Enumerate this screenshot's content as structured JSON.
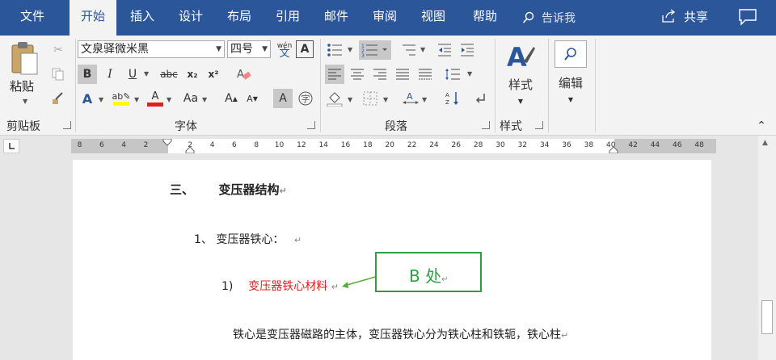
{
  "tabs": {
    "file": "文件",
    "home": "开始",
    "insert": "插入",
    "design": "设计",
    "layout": "布局",
    "references": "引用",
    "mailings": "邮件",
    "review": "审阅",
    "view": "视图",
    "help": "帮助"
  },
  "tellme": {
    "placeholder": "告诉我"
  },
  "share": {
    "label": "共享"
  },
  "ribbon": {
    "clipboard": {
      "paste_label": "粘贴",
      "group_label": "剪贴板"
    },
    "font": {
      "group_label": "字体",
      "font_name": "文泉驿微米黑",
      "font_size": "四号",
      "bold": "B",
      "italic": "I",
      "underline": "U",
      "strike": "abc",
      "subscript": "x₂",
      "superscript": "x²",
      "case_label": "Aa",
      "grow": "A",
      "shrink": "A",
      "phonetic": "wén",
      "highlight_color": "#ffff00",
      "font_color": "#e02020"
    },
    "paragraph": {
      "group_label": "段落"
    },
    "styles": {
      "label": "样式",
      "group_label": "样式"
    },
    "editing": {
      "label": "编辑"
    }
  },
  "ruler": {
    "left_numbers": [
      "8",
      "6",
      "4",
      "2"
    ],
    "numbers": [
      "2",
      "4",
      "6",
      "8",
      "10",
      "12",
      "14",
      "16",
      "18",
      "20",
      "22",
      "24",
      "26",
      "28",
      "30",
      "32",
      "34",
      "36",
      "38",
      "40",
      "42",
      "44",
      "46",
      "48"
    ]
  },
  "document": {
    "heading_num": "三、",
    "heading_text": "变压器结构",
    "subheading": "1、 变压器铁心：",
    "item_num": "1)",
    "item_text": "变压器铁心材料",
    "item_color": "#e02020",
    "body_text": "铁心是变压器磁路的主体，变压器铁心分为铁心柱和铁轭，铁心柱",
    "callout_text": "B 处",
    "callout_color": "#2f9e44"
  }
}
